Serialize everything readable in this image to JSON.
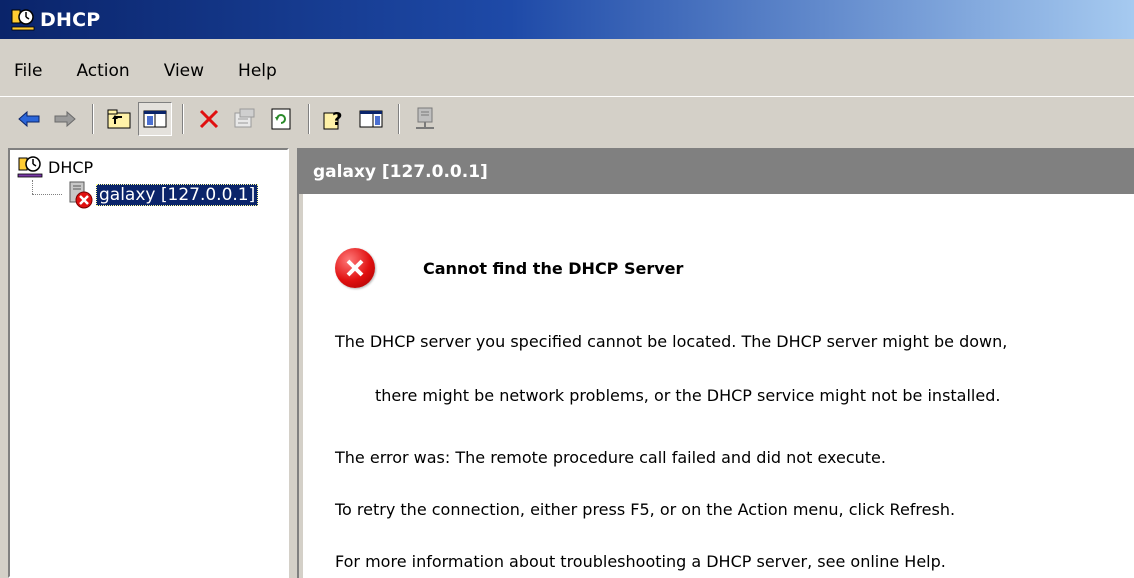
{
  "window": {
    "title": "DHCP"
  },
  "menu": {
    "items": [
      {
        "label": "File"
      },
      {
        "label": "Action"
      },
      {
        "label": "View"
      },
      {
        "label": "Help"
      }
    ]
  },
  "toolbar": {
    "buttons": [
      {
        "icon": "back-arrow-icon"
      },
      {
        "icon": "forward-arrow-icon"
      },
      {
        "icon": "up-folder-icon"
      },
      {
        "icon": "show-hide-tree-icon",
        "pressed": true
      },
      {
        "icon": "delete-icon"
      },
      {
        "icon": "properties-icon"
      },
      {
        "icon": "refresh-icon"
      },
      {
        "icon": "help-icon"
      },
      {
        "icon": "show-hide-action-pane-icon"
      },
      {
        "icon": "server-icon"
      }
    ]
  },
  "tree": {
    "root_label": "DHCP",
    "child_label": "galaxy [127.0.0.1]",
    "child_status": "error"
  },
  "result": {
    "header": "galaxy [127.0.0.1]",
    "error_title": "Cannot find the DHCP Server",
    "line1": "The DHCP server you specified cannot be located. The DHCP server might be down,",
    "line2": "there might be  network problems, or the DHCP service might not be installed.",
    "line3": "The error was:  The remote procedure call failed and did not execute.",
    "line4": "To retry the connection, either press F5, or on the Action menu, click Refresh.",
    "line5": "For more information about troubleshooting a DHCP server, see online Help."
  },
  "colors": {
    "titlebar_start": "#0a246a",
    "titlebar_end": "#a6caf0",
    "chrome": "#d4d0c8",
    "selection": "#0a246a",
    "header_gray": "#808080",
    "error_red": "#e01010"
  }
}
